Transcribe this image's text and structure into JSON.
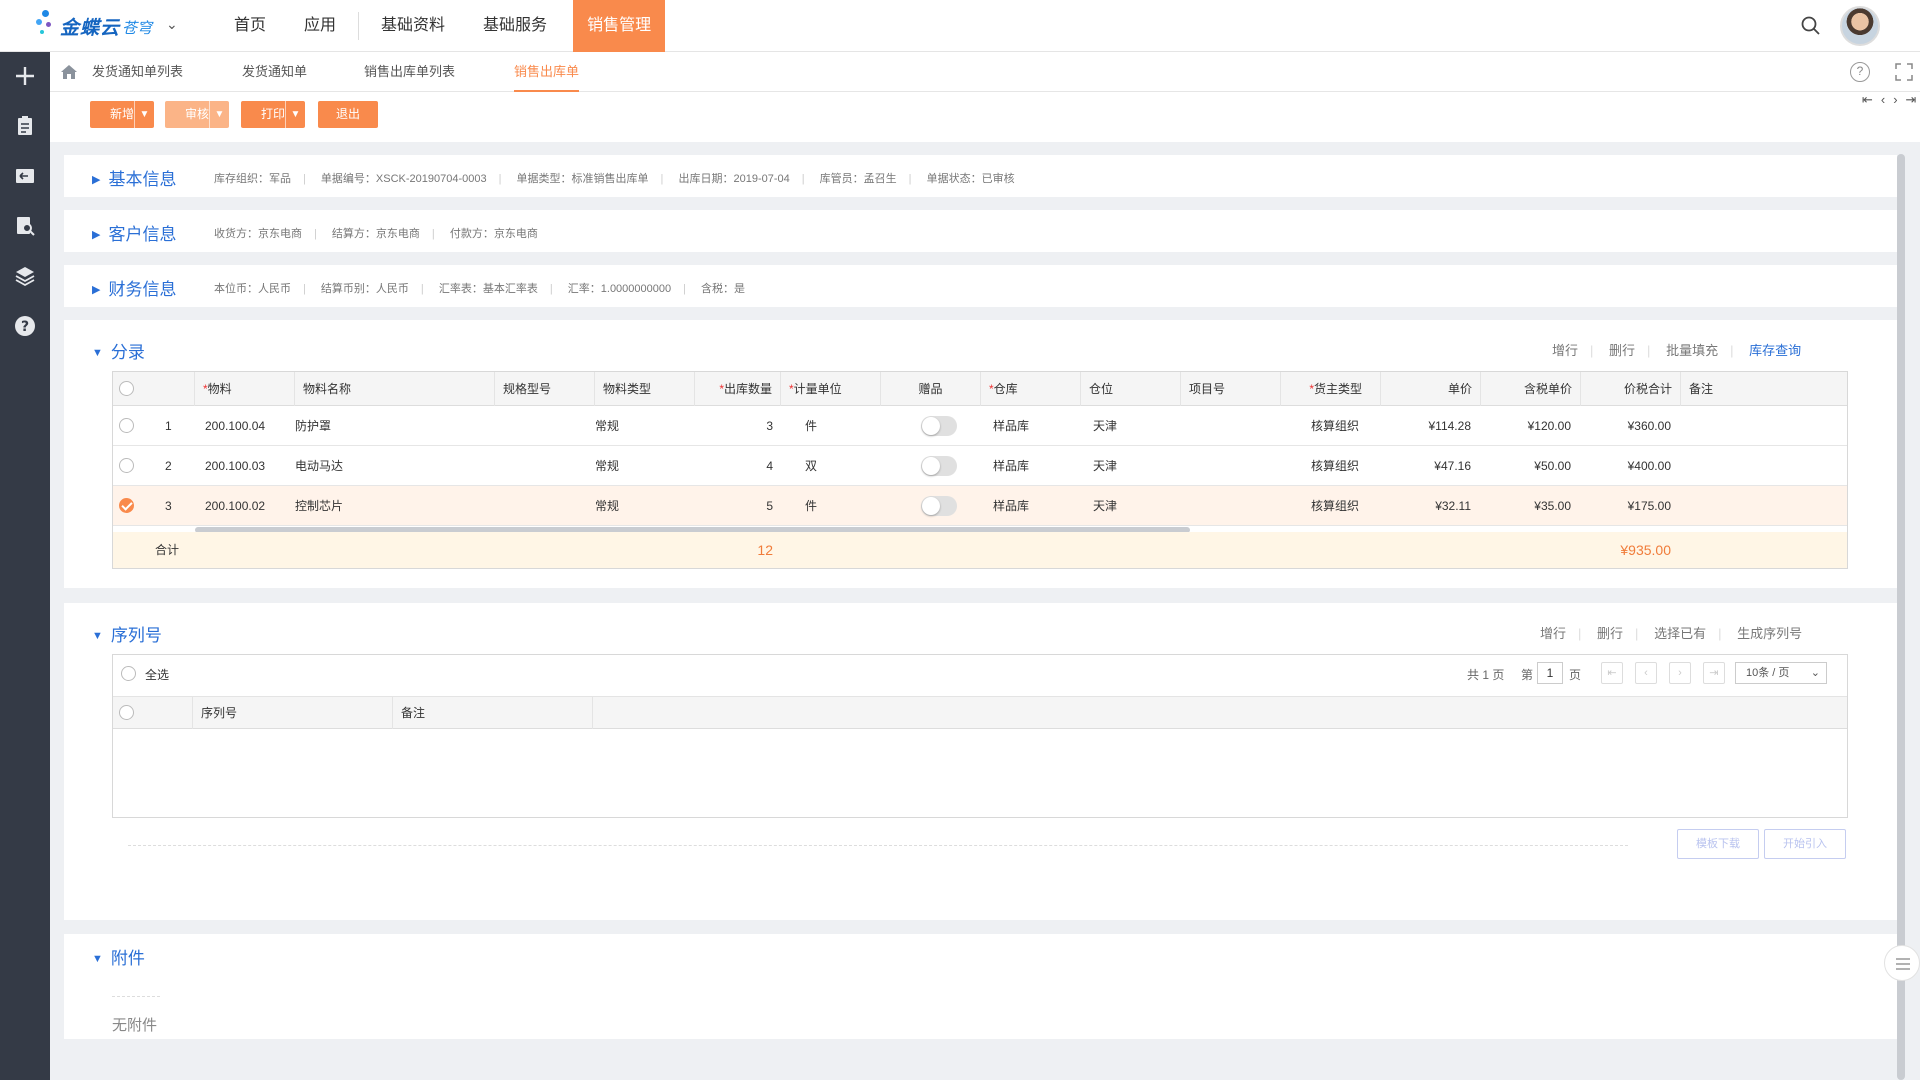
{
  "app": {
    "logo_text": "金蝶云",
    "logo_sub": "苍穹"
  },
  "nav": {
    "items": [
      "首页",
      "应用",
      "基础资料",
      "基础服务"
    ],
    "active": "销售管理"
  },
  "tabs": [
    "发货通知单列表",
    "发货通知单",
    "销售出库单列表",
    "销售出库单"
  ],
  "help_glyph": "?",
  "toolbar": {
    "new": "新增",
    "audit": "审核",
    "print": "打印",
    "exit": "退出",
    "pager": "⇤‹›⇥"
  },
  "basic": {
    "title": "基本信息",
    "fields": [
      "库存组织：军品",
      "单据编号：XSCK-20190704-0003",
      "单据类型：标准销售出库单",
      "出库日期：2019-07-04",
      "库管员：孟召生",
      "单据状态：已审核"
    ]
  },
  "customer": {
    "title": "客户信息",
    "fields": [
      "收货方：京东电商",
      "结算方：京东电商",
      "付款方：京东电商"
    ]
  },
  "finance": {
    "title": "财务信息",
    "fields": [
      "本位币：人民币",
      "结算币别：人民币",
      "汇率表：基本汇率表",
      "汇率：1.0000000000",
      "含税：是"
    ]
  },
  "entries": {
    "title": "分录",
    "actions": [
      "增行",
      "删行",
      "批量填充",
      "库存查询"
    ],
    "columns": [
      "物料",
      "物料名称",
      "规格型号",
      "物料类型",
      "出库数量",
      "计量单位",
      "赠品",
      "仓库",
      "仓位",
      "项目号",
      "货主类型",
      "单价",
      "含税单价",
      "价税合计",
      "备注"
    ],
    "rows": [
      {
        "seq": "1",
        "code": "200.100.04",
        "name": "防护罩",
        "type": "常规",
        "qty": "3",
        "unit": "件",
        "wh": "样品库",
        "loc": "天津",
        "owner": "核算组织",
        "price": "¥114.28",
        "tax_price": "¥120.00",
        "total": "¥360.00"
      },
      {
        "seq": "2",
        "code": "200.100.03",
        "name": "电动马达",
        "type": "常规",
        "qty": "4",
        "unit": "双",
        "wh": "样品库",
        "loc": "天津",
        "owner": "核算组织",
        "price": "¥47.16",
        "tax_price": "¥50.00",
        "total": "¥400.00"
      },
      {
        "seq": "3",
        "code": "200.100.02",
        "name": "控制芯片",
        "type": "常规",
        "qty": "5",
        "unit": "件",
        "wh": "样品库",
        "loc": "天津",
        "owner": "核算组织",
        "price": "¥32.11",
        "tax_price": "¥35.00",
        "total": "¥175.00"
      }
    ],
    "total_label": "合计",
    "total_qty": "12",
    "total_amount": "¥935.00"
  },
  "serial": {
    "title": "序列号",
    "actions": [
      "增行",
      "删行",
      "选择已有",
      "生成序列号"
    ],
    "select_all": "全选",
    "total_pages": "共 1 页",
    "page_prefix": "第",
    "page_value": "1",
    "page_suffix": "页",
    "page_size": "10条 / 页",
    "columns": [
      "序列号",
      "备注"
    ],
    "download": "模板下载",
    "import": "开始引入"
  },
  "attachment": {
    "title": "附件",
    "empty": "无附件"
  },
  "colors": {
    "accent": "#f98a4c",
    "link": "#2a6fd6",
    "sidebar": "#343a46"
  }
}
